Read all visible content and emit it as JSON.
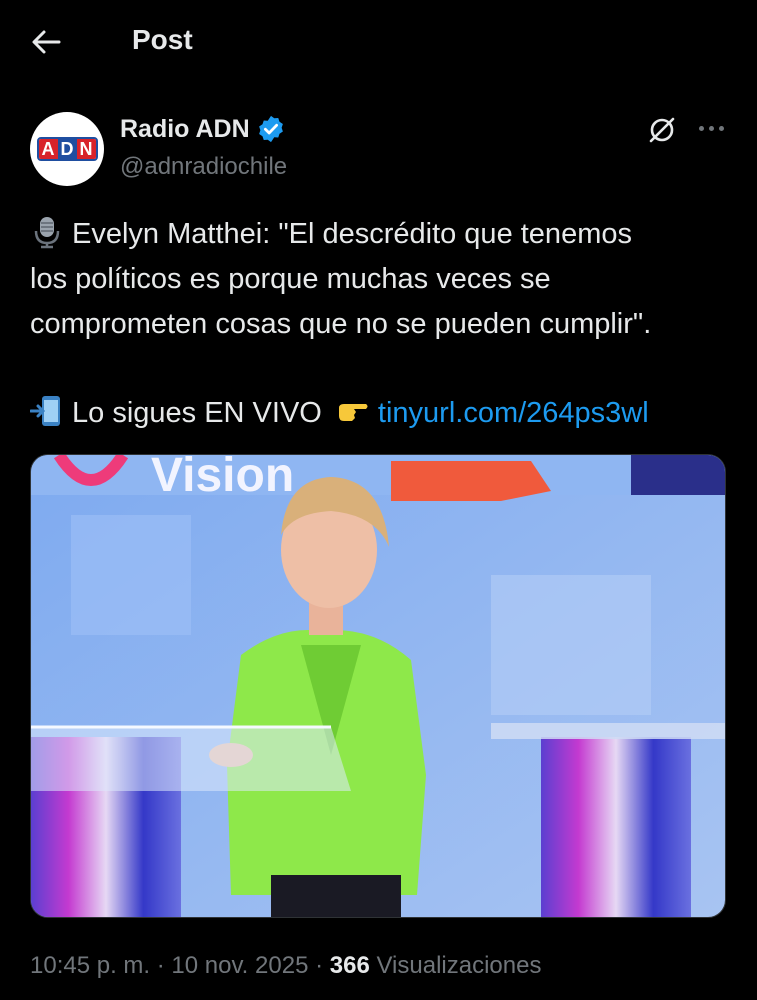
{
  "header": {
    "title": "Post",
    "back_icon": "arrow-left-icon"
  },
  "author": {
    "name": "Radio ADN",
    "handle": "@adnradiochile",
    "verified": true,
    "logo_letters": [
      "A",
      "D",
      "N"
    ]
  },
  "tweet": {
    "line1": "Evelyn Matthei: \"El descrédito que tenemos",
    "line2": "los políticos es porque muchas veces se",
    "line3": "comprometen cosas que no se pueden cumplir\".",
    "live_text": "Lo sigues EN VIVO",
    "link": "tinyurl.com/264ps3wl",
    "emoji_mic": "microphone-emoji",
    "emoji_phone": "mobile-arrow-emoji",
    "emoji_point": "pointing-right-emoji"
  },
  "media": {
    "backdrop_text": "Vision"
  },
  "meta": {
    "time": "10:45 p. m.",
    "sep1": " · ",
    "date": "10 nov. 2025",
    "sep2": " · ",
    "views": "366",
    "views_label": " Visualizaciones"
  },
  "colors": {
    "accent": "#1d9bf0",
    "muted": "#71767b",
    "text": "#e7e9ea",
    "background": "#000000"
  }
}
